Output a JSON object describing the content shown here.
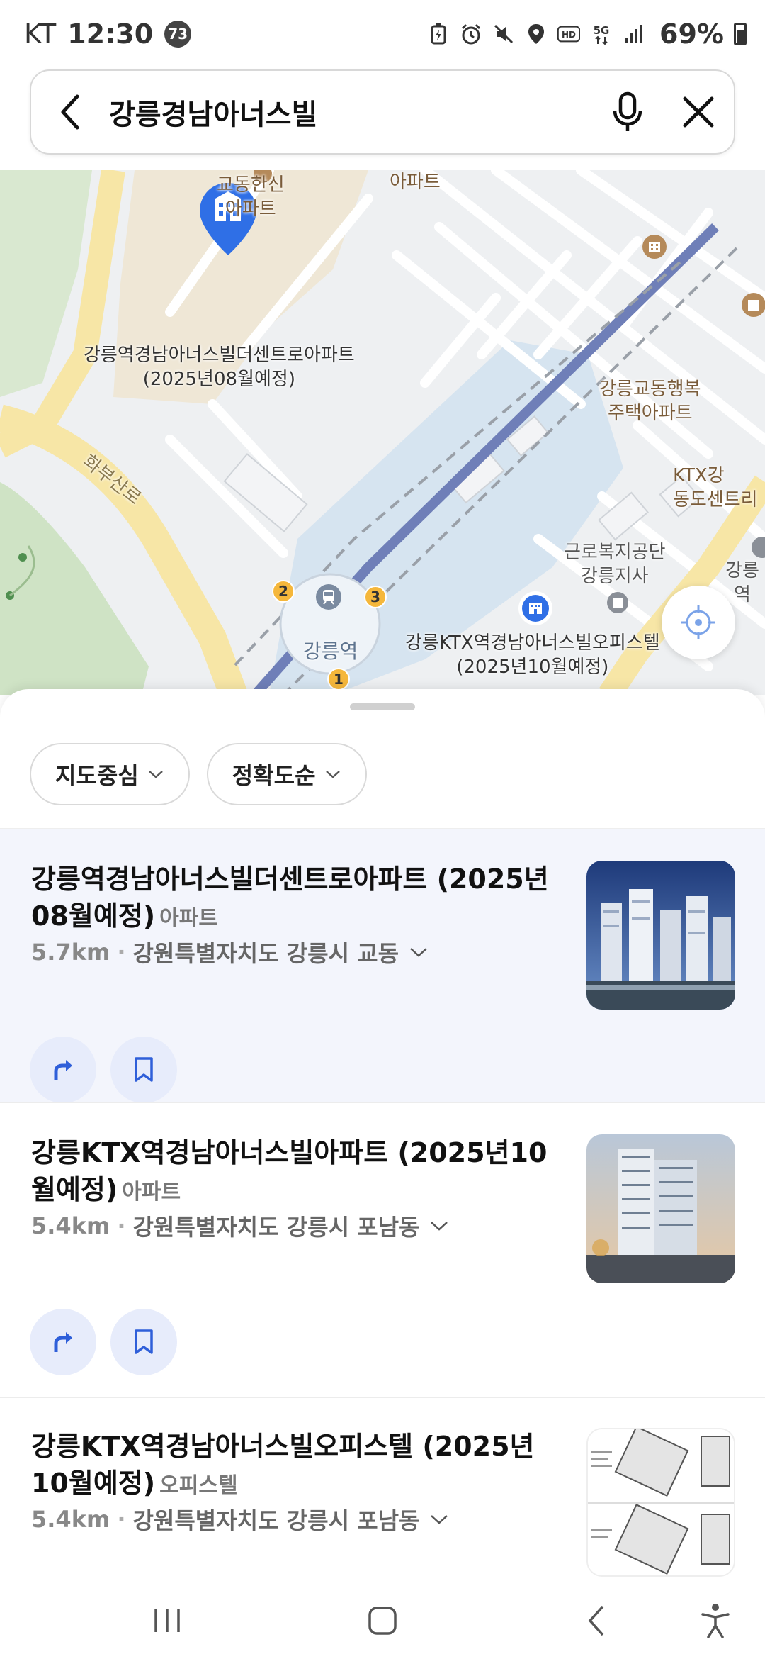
{
  "status_bar": {
    "carrier": "KT",
    "time": "12:30",
    "notification_badge": "73",
    "battery": "69%",
    "icons": [
      "battery-saver-icon",
      "alarm-icon",
      "mute-icon",
      "location-icon",
      "hd-icon",
      "5g-icon",
      "signal-icon",
      "battery-icon"
    ]
  },
  "search": {
    "query": "강릉경남아너스빌"
  },
  "map": {
    "labels": {
      "gyodong_hanshin": "교동한신\n아파트",
      "apt_top": "아파트",
      "selected_place": "강릉역경남아너스빌더센트로아파트\n(2025년08월예정)",
      "haengbok": "강릉교동행복\n주택아파트",
      "ktx_dongdo": "KTX강\n동도센트리",
      "hwabu_road": "화부산로",
      "geunro": "근로복지공단\n강릉지사",
      "gangneung_right": "강릉역",
      "station": "강릉역",
      "officetel": "강릉KTX역경남아너스빌오피스텔\n(2025년10월예정)",
      "exit_1": "1",
      "exit_2": "2",
      "exit_3": "3"
    },
    "colors": {
      "pin_blue": "#2f6fe6",
      "road_yellow": "#f7e6a6",
      "rail_blue": "#6f7fb8",
      "water_blue": "#d6e4f0",
      "park_green": "#cfe3c5",
      "exit_orange": "#f5b73b"
    }
  },
  "filters": [
    {
      "label": "지도중심"
    },
    {
      "label": "정확도순"
    }
  ],
  "results": [
    {
      "title": "강릉역경남아너스빌더센트로아파트 (2025년08월예정)",
      "category": "아파트",
      "distance": "5.7km",
      "address": "강원특별자치도 강릉시 교동"
    },
    {
      "title": "강릉KTX역경남아너스빌아파트 (2025년10월예정)",
      "category": "아파트",
      "distance": "5.4km",
      "address": "강원특별자치도 강릉시 포남동"
    },
    {
      "title": "강릉KTX역경남아너스빌오피스텔 (2025년10월예정)",
      "category": "오피스텔",
      "distance": "5.4km",
      "address": "강원특별자치도 강릉시 포남동"
    }
  ],
  "accent_color": "#2f5fd9"
}
